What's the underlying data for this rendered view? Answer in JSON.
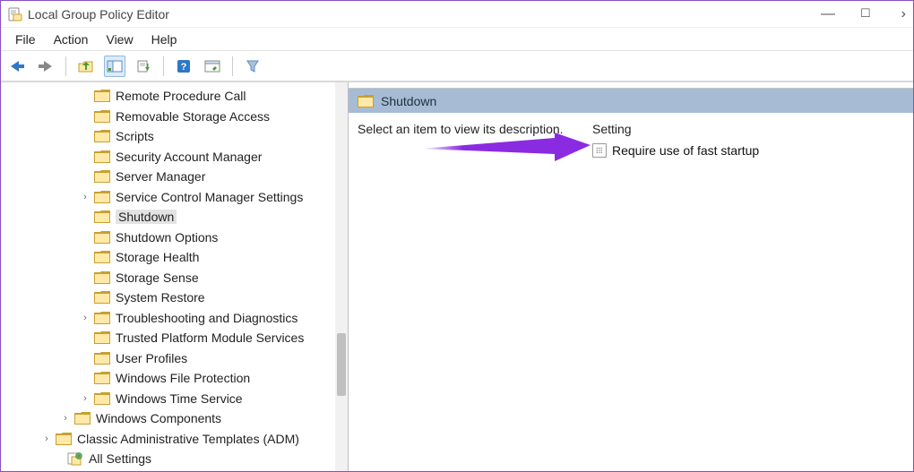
{
  "window": {
    "title": "Local Group Policy Editor"
  },
  "menubar": {
    "items": [
      "File",
      "Action",
      "View",
      "Help"
    ]
  },
  "tree": {
    "items": [
      {
        "label": "Remote Procedure Call",
        "level": "lv0",
        "expandable": false
      },
      {
        "label": "Removable Storage Access",
        "level": "lv0",
        "expandable": false
      },
      {
        "label": "Scripts",
        "level": "lv0",
        "expandable": false
      },
      {
        "label": "Security Account Manager",
        "level": "lv0",
        "expandable": false
      },
      {
        "label": "Server Manager",
        "level": "lv0",
        "expandable": false
      },
      {
        "label": "Service Control Manager Settings",
        "level": "lv0",
        "expandable": true
      },
      {
        "label": "Shutdown",
        "level": "lv0",
        "expandable": false,
        "selected": true
      },
      {
        "label": "Shutdown Options",
        "level": "lv0",
        "expandable": false
      },
      {
        "label": "Storage Health",
        "level": "lv0",
        "expandable": false
      },
      {
        "label": "Storage Sense",
        "level": "lv0",
        "expandable": false
      },
      {
        "label": "System Restore",
        "level": "lv0",
        "expandable": false
      },
      {
        "label": "Troubleshooting and Diagnostics",
        "level": "lv0",
        "expandable": true
      },
      {
        "label": "Trusted Platform Module Services",
        "level": "lv0",
        "expandable": false
      },
      {
        "label": "User Profiles",
        "level": "lv0",
        "expandable": false
      },
      {
        "label": "Windows File Protection",
        "level": "lv0",
        "expandable": false
      },
      {
        "label": "Windows Time Service",
        "level": "lv0",
        "expandable": true
      },
      {
        "label": "Windows Components",
        "level": "lv1",
        "expandable": true
      },
      {
        "label": "Classic Administrative Templates (ADM)",
        "level": "lv2",
        "expandable": true
      },
      {
        "label": "All Settings",
        "level": "lv3",
        "expandable": false,
        "icon": "allsettings"
      }
    ]
  },
  "content": {
    "header_title": "Shutdown",
    "description_placeholder": "Select an item to view its description.",
    "column_header": "Setting",
    "list_items": [
      "Require use of fast startup"
    ]
  }
}
